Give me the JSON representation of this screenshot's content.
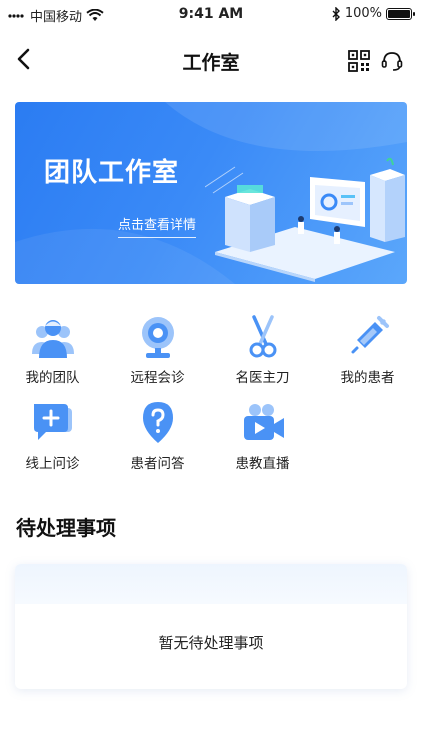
{
  "status_bar": {
    "carrier": "中国移动",
    "time": "9:41 AM",
    "battery_percent": "100%",
    "battery_level": 1.0,
    "icons": [
      "signal-icon",
      "wifi-icon",
      "bluetooth-icon",
      "battery-icon"
    ]
  },
  "navbar": {
    "title": "工作室",
    "icons": [
      "back-arrow-icon",
      "qr-code-icon",
      "customer-service-icon"
    ]
  },
  "banner": {
    "title": "团队工作室",
    "link_text": "点击查看详情",
    "colors": {
      "start": "#2b7cf2",
      "end": "#5ba7fb"
    }
  },
  "menu": {
    "items": [
      {
        "label": "我的团队",
        "icon": "team-icon"
      },
      {
        "label": "远程会诊",
        "icon": "webcam-icon"
      },
      {
        "label": "名医主刀",
        "icon": "scissors-icon"
      },
      {
        "label": "我的患者",
        "icon": "syringe-icon"
      },
      {
        "label": "线上问诊",
        "icon": "chat-plus-icon"
      },
      {
        "label": "患者问答",
        "icon": "question-icon"
      },
      {
        "label": "患教直播",
        "icon": "video-camera-icon"
      }
    ]
  },
  "pending": {
    "title": "待处理事项",
    "empty_text": "暂无待处理事项"
  },
  "colors": {
    "accent": "#3a8af7",
    "icon_blue": "#4a92f5"
  }
}
